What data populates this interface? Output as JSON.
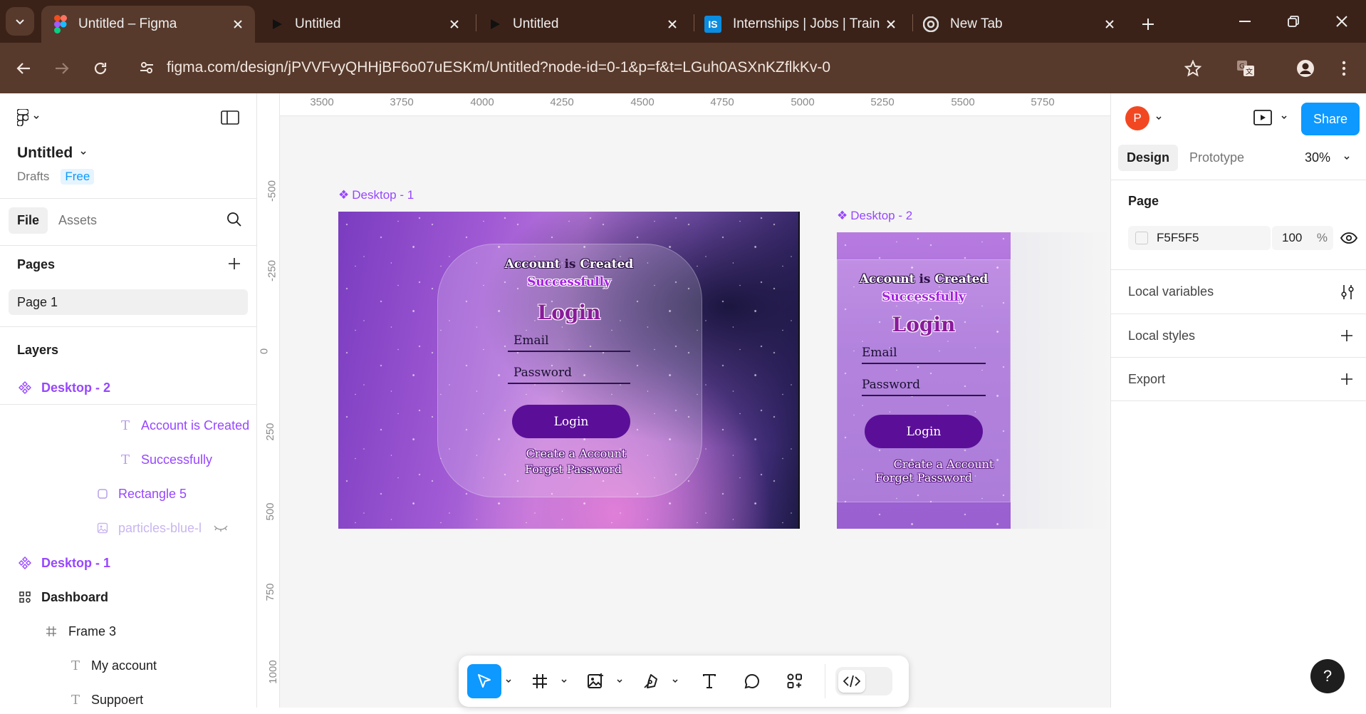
{
  "browser": {
    "tabs": [
      {
        "title": "Untitled – Figma",
        "icon": "figma-icon",
        "active": true
      },
      {
        "title": "Untitled",
        "icon": "play-icon"
      },
      {
        "title": "Untitled",
        "icon": "play-icon"
      },
      {
        "title": "Internships | Jobs | Training",
        "icon": "internshala-icon"
      },
      {
        "title": "New Tab",
        "icon": "chrome-icon"
      }
    ],
    "url": "figma.com/design/jPVVFvyQHHjBF6o07uESKm/Untitled?node-id=0-1&p=f&t=LGuh0ASXnKZflkKv-0"
  },
  "file": {
    "name": "Untitled",
    "location": "Drafts",
    "plan": "Free"
  },
  "left_panel": {
    "tabs": {
      "file": "File",
      "assets": "Assets"
    },
    "pages_heading": "Pages",
    "pages": [
      "Page 1"
    ],
    "layers_heading": "Layers",
    "layers": [
      {
        "label": "Desktop - 2",
        "type": "component"
      },
      {
        "label": "Account is Created",
        "type": "text"
      },
      {
        "label": "Successfully",
        "type": "text"
      },
      {
        "label": "Rectangle 5",
        "type": "rectangle"
      },
      {
        "label": "particles-blue-l",
        "type": "image"
      },
      {
        "label": "Desktop - 1",
        "type": "component"
      },
      {
        "label": "Dashboard",
        "type": "section"
      },
      {
        "label": "Frame 3",
        "type": "frame"
      },
      {
        "label": "My account",
        "type": "text"
      },
      {
        "label": "Suppoert",
        "type": "text"
      }
    ]
  },
  "canvas": {
    "ruler_top": [
      "3500",
      "3750",
      "4000",
      "4250",
      "4500",
      "4750",
      "5000",
      "5250",
      "5500",
      "5750"
    ],
    "ruler_left": [
      "-500",
      "-250",
      "0",
      "250",
      "500",
      "750",
      "1000"
    ],
    "frames": [
      {
        "label": "Desktop - 1",
        "title1a": "Account",
        "title1b": "is",
        "title1c": "Created",
        "title2": "Successfully",
        "heading": "Login",
        "email": "Email",
        "password": "Password",
        "button": "Login",
        "link1": "Create a Account",
        "link2": "Forget Password"
      },
      {
        "label": "Desktop - 2",
        "title1a": "Account",
        "title1b": "is",
        "title1c": "Created",
        "title2": "Successfully",
        "heading": "Login",
        "email": "Email",
        "password": "Password",
        "button": "Login",
        "link1": "Create a Account",
        "link2": "Forget Password"
      }
    ]
  },
  "right_panel": {
    "avatar_letter": "P",
    "share": "Share",
    "tabs": {
      "design": "Design",
      "prototype": "Prototype"
    },
    "zoom": "30%",
    "page_heading": "Page",
    "page_color": "F5F5F5",
    "page_opacity": "100",
    "percent_sign": "%",
    "sections": [
      "Local variables",
      "Local styles",
      "Export"
    ]
  },
  "help": "?",
  "colors": {
    "accent": "#0d99ff",
    "component": "#9747ff",
    "chrome_dark": "#3b2218",
    "chrome_toolbar": "#573a2c"
  }
}
